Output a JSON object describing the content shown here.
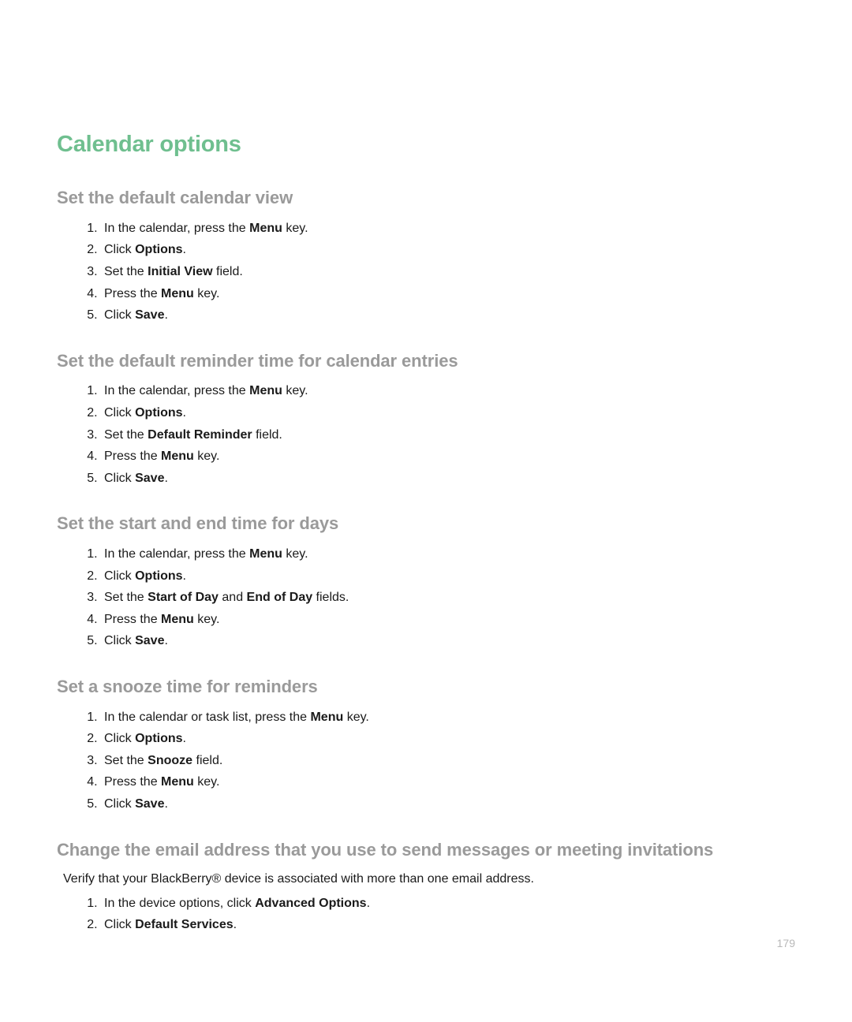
{
  "page_title": "Calendar options",
  "page_number": "179",
  "sections": [
    {
      "heading": "Set the default calendar view",
      "intro": null,
      "steps": [
        [
          {
            "t": "In the calendar, press the "
          },
          {
            "t": "Menu",
            "b": true
          },
          {
            "t": " key."
          }
        ],
        [
          {
            "t": "Click "
          },
          {
            "t": "Options",
            "b": true
          },
          {
            "t": "."
          }
        ],
        [
          {
            "t": "Set the "
          },
          {
            "t": "Initial View",
            "b": true
          },
          {
            "t": " field."
          }
        ],
        [
          {
            "t": "Press the "
          },
          {
            "t": "Menu",
            "b": true
          },
          {
            "t": " key."
          }
        ],
        [
          {
            "t": "Click "
          },
          {
            "t": "Save",
            "b": true
          },
          {
            "t": "."
          }
        ]
      ]
    },
    {
      "heading": "Set the default reminder time for calendar entries",
      "intro": null,
      "steps": [
        [
          {
            "t": "In the calendar, press the "
          },
          {
            "t": "Menu",
            "b": true
          },
          {
            "t": " key."
          }
        ],
        [
          {
            "t": "Click "
          },
          {
            "t": "Options",
            "b": true
          },
          {
            "t": "."
          }
        ],
        [
          {
            "t": "Set the "
          },
          {
            "t": "Default Reminder",
            "b": true
          },
          {
            "t": " field."
          }
        ],
        [
          {
            "t": "Press the "
          },
          {
            "t": "Menu",
            "b": true
          },
          {
            "t": " key."
          }
        ],
        [
          {
            "t": "Click "
          },
          {
            "t": "Save",
            "b": true
          },
          {
            "t": "."
          }
        ]
      ]
    },
    {
      "heading": "Set the start and end time for days",
      "intro": null,
      "steps": [
        [
          {
            "t": "In the calendar, press the "
          },
          {
            "t": "Menu",
            "b": true
          },
          {
            "t": " key."
          }
        ],
        [
          {
            "t": "Click "
          },
          {
            "t": "Options",
            "b": true
          },
          {
            "t": "."
          }
        ],
        [
          {
            "t": "Set the "
          },
          {
            "t": "Start of Day",
            "b": true
          },
          {
            "t": " and "
          },
          {
            "t": "End of Day",
            "b": true
          },
          {
            "t": " fields."
          }
        ],
        [
          {
            "t": "Press the "
          },
          {
            "t": "Menu",
            "b": true
          },
          {
            "t": " key."
          }
        ],
        [
          {
            "t": "Click "
          },
          {
            "t": "Save",
            "b": true
          },
          {
            "t": "."
          }
        ]
      ]
    },
    {
      "heading": "Set a snooze time for reminders",
      "intro": null,
      "steps": [
        [
          {
            "t": "In the calendar or task list, press the "
          },
          {
            "t": "Menu",
            "b": true
          },
          {
            "t": " key."
          }
        ],
        [
          {
            "t": "Click "
          },
          {
            "t": "Options",
            "b": true
          },
          {
            "t": "."
          }
        ],
        [
          {
            "t": "Set the "
          },
          {
            "t": "Snooze",
            "b": true
          },
          {
            "t": " field."
          }
        ],
        [
          {
            "t": "Press the "
          },
          {
            "t": "Menu",
            "b": true
          },
          {
            "t": " key."
          }
        ],
        [
          {
            "t": "Click "
          },
          {
            "t": "Save",
            "b": true
          },
          {
            "t": "."
          }
        ]
      ]
    },
    {
      "heading": "Change the email address that you use to send messages or meeting invitations",
      "intro": "Verify that your BlackBerry® device is associated with more than one email address.",
      "steps": [
        [
          {
            "t": "In the device options, click "
          },
          {
            "t": "Advanced Options",
            "b": true
          },
          {
            "t": "."
          }
        ],
        [
          {
            "t": "Click "
          },
          {
            "t": "Default Services",
            "b": true
          },
          {
            "t": "."
          }
        ]
      ]
    }
  ]
}
